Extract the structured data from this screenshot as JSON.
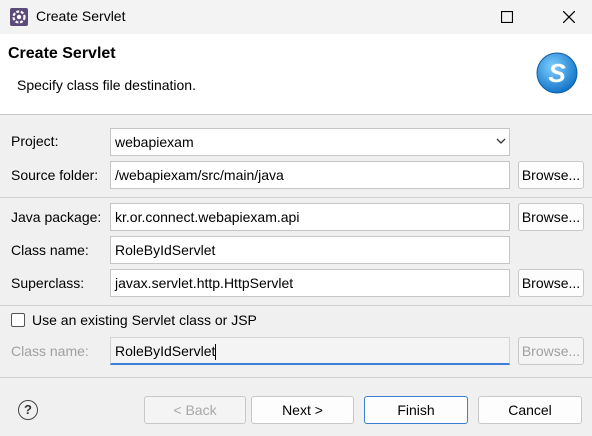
{
  "window": {
    "title": "Create Servlet",
    "icons": [
      "app-gear-icon",
      "maximize-icon",
      "close-icon"
    ]
  },
  "banner": {
    "title": "Create Servlet",
    "subtitle": "Specify class file destination.",
    "logo_text": "S"
  },
  "form": {
    "project": {
      "label": "Project:",
      "value": "webapiexam"
    },
    "source_folder": {
      "label": "Source folder:",
      "value": "/webapiexam/src/main/java",
      "button": "Browse..."
    },
    "java_package": {
      "label": "Java package:",
      "value": "kr.or.connect.webapiexam.api",
      "button": "Browse..."
    },
    "class_name": {
      "label": "Class name:",
      "value": "RoleByIdServlet"
    },
    "superclass": {
      "label": "Superclass:",
      "value": "javax.servlet.http.HttpServlet",
      "button": "Browse..."
    },
    "use_existing": {
      "label": "Use an existing Servlet class or JSP",
      "checked": false
    },
    "existing_class": {
      "label": "Class name:",
      "value": "RoleByIdServlet",
      "button": "Browse..."
    }
  },
  "footer": {
    "back": "< Back",
    "next": "Next >",
    "finish": "Finish",
    "cancel": "Cancel",
    "help": "?"
  },
  "colors": {
    "accent": "#3b7fd6",
    "disabled_text": "#a0a0a0",
    "logo_blue": "#1e8ad6"
  }
}
